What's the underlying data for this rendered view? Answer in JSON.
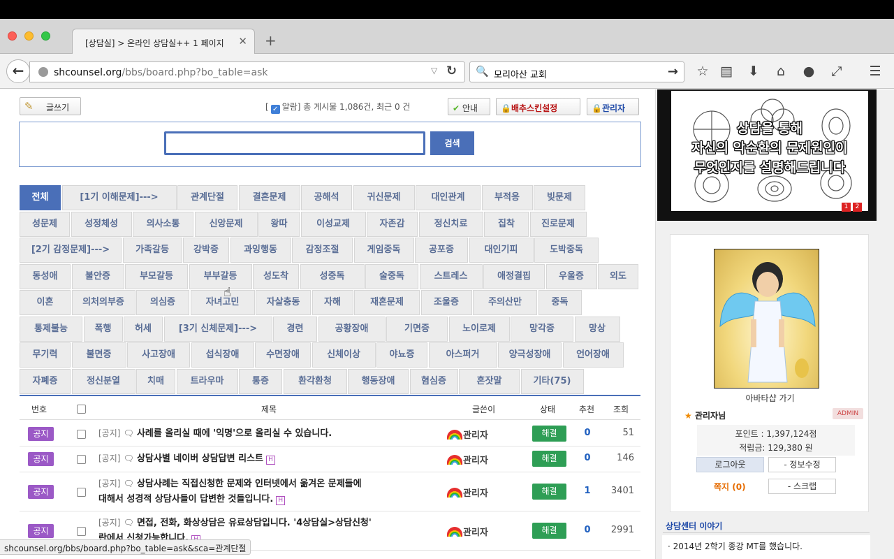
{
  "browser": {
    "tab_title": "[상담실] > 온라인 상담실++ 1 페이지",
    "tab_close": "✕",
    "new_tab": "+",
    "url_domain": "shcounsel.org",
    "url_path": "/bbs/board.php?bo_table=ask",
    "search_text": "모리아산 교회",
    "status_url": "shcounsel.org/bbs/board.php?bo_table=ask&sca=관계단절"
  },
  "toolbar": {
    "write_label": "글쓰기",
    "info_open": "[",
    "info_text": "알람] 총 게시물 1,086건, 최근 0 건",
    "guide_label": "안내",
    "skin_label": "배추스킨설정",
    "admin_label": "관리자"
  },
  "search": {
    "button_label": "검색",
    "placeholder": ""
  },
  "categories": [
    [
      {
        "label": "전체",
        "active": true
      },
      {
        "label": "[1기 이해문제]--->"
      },
      {
        "label": "관계단절"
      },
      {
        "label": "결혼문제"
      },
      {
        "label": "공해석"
      },
      {
        "label": "귀신문제"
      },
      {
        "label": "대인관계"
      },
      {
        "label": "부적응"
      },
      {
        "label": "빚문제"
      }
    ],
    [
      {
        "label": "성문제"
      },
      {
        "label": "성정체성"
      },
      {
        "label": "의사소통"
      },
      {
        "label": "신앙문제"
      },
      {
        "label": "왕따"
      },
      {
        "label": "이성교제"
      },
      {
        "label": "자존감"
      },
      {
        "label": "정신치료"
      },
      {
        "label": "집착"
      },
      {
        "label": "진로문제"
      }
    ],
    [
      {
        "label": "[2기 감정문제]--->"
      },
      {
        "label": "가족갈등"
      },
      {
        "label": "강박증"
      },
      {
        "label": "과잉행동"
      },
      {
        "label": "감정조절"
      },
      {
        "label": "게임중독"
      },
      {
        "label": "공포증"
      },
      {
        "label": "대인기피"
      },
      {
        "label": "도박중독"
      }
    ],
    [
      {
        "label": "동성애"
      },
      {
        "label": "불안증"
      },
      {
        "label": "부모갈등"
      },
      {
        "label": "부부갈등"
      },
      {
        "label": "성도착"
      },
      {
        "label": "성중독"
      },
      {
        "label": "술중독"
      },
      {
        "label": "스트레스"
      },
      {
        "label": "애정결핍"
      },
      {
        "label": "우울증"
      },
      {
        "label": "외도"
      }
    ],
    [
      {
        "label": "이혼"
      },
      {
        "label": "의처의부증"
      },
      {
        "label": "의심증"
      },
      {
        "label": "자녀고민"
      },
      {
        "label": "자살충동"
      },
      {
        "label": "자해"
      },
      {
        "label": "재혼문제"
      },
      {
        "label": "조울증"
      },
      {
        "label": "주의산만"
      },
      {
        "label": "중독"
      }
    ],
    [
      {
        "label": "통제불능"
      },
      {
        "label": "폭행"
      },
      {
        "label": "허세"
      },
      {
        "label": "[3기 신체문제]--->"
      },
      {
        "label": "경련"
      },
      {
        "label": "공황장애"
      },
      {
        "label": "기면증"
      },
      {
        "label": "노이로제"
      },
      {
        "label": "망각증"
      },
      {
        "label": "망상"
      }
    ],
    [
      {
        "label": "무기력"
      },
      {
        "label": "불면증"
      },
      {
        "label": "사고장애"
      },
      {
        "label": "섭식장애"
      },
      {
        "label": "수면장애"
      },
      {
        "label": "신체이상"
      },
      {
        "label": "야뇨증"
      },
      {
        "label": "아스퍼거"
      },
      {
        "label": "양극성장애"
      },
      {
        "label": "언어장애"
      }
    ],
    [
      {
        "label": "자폐증"
      },
      {
        "label": "정신분열"
      },
      {
        "label": "치매"
      },
      {
        "label": "트라우마"
      },
      {
        "label": "통증"
      },
      {
        "label": "환각환청"
      },
      {
        "label": "행동장애"
      },
      {
        "label": "혐심증"
      },
      {
        "label": "혼잣말"
      },
      {
        "label": "기타(75)"
      }
    ]
  ],
  "table": {
    "headers": {
      "num": "번호",
      "title": "제목",
      "writer": "글쓴이",
      "status": "상태",
      "recommend": "추천",
      "views": "조회"
    },
    "rows": [
      {
        "badge": "공지",
        "prefix": "[공지]",
        "title": "사례를 올리실 때에 '익명'으로 올리실 수 있습니다.",
        "line2": "",
        "has_h": false,
        "writer": "관리자",
        "status": "해결",
        "recommend": "0",
        "views": "51"
      },
      {
        "badge": "공지",
        "prefix": "[공지]",
        "title": "상담사별 네이버 상담답변 리스트",
        "line2": "",
        "has_h": true,
        "writer": "관리자",
        "status": "해결",
        "recommend": "0",
        "views": "146"
      },
      {
        "badge": "공지",
        "prefix": "[공지]",
        "title": "상담사례는 직접신청한 문제와 인터넷에서 옮겨온 문제들에",
        "line2": "대해서 성경적 상담사들이 답변한 것들입니다.",
        "has_h": true,
        "writer": "관리자",
        "status": "해결",
        "recommend": "1",
        "views": "3401"
      },
      {
        "badge": "공지",
        "prefix": "[공지]",
        "title": "면접, 전화, 화상상담은 유료상담입니다. '4상담실>상담신청'",
        "line2": "란에서 신청가능합니다.",
        "has_h": true,
        "writer": "관리자",
        "status": "해결",
        "recommend": "0",
        "views": "2991"
      }
    ],
    "h_badge": "H"
  },
  "sidebar": {
    "banner_line1": "상담을 통해",
    "banner_line2": "자신의 악순환의 문제원인이",
    "banner_line3": "무엇인지를 설명해드립니다",
    "banner_page1": "1",
    "banner_page2": "2",
    "avatar_link": "아바타샵 가기",
    "admin_name": "관리자님",
    "admin_tag": "ADMIN",
    "points": "포인트 : 1,397,124점",
    "savings": "적립금: 129,380 원",
    "logout_label": "로그아웃",
    "edit_label": "정보수정",
    "memo_label": "쪽지 (0)",
    "scrap_label": "스크랩",
    "center_title": "상담센터 이야기",
    "center_item": "· 2014년 2학기 종강 MT를 했습니다."
  }
}
